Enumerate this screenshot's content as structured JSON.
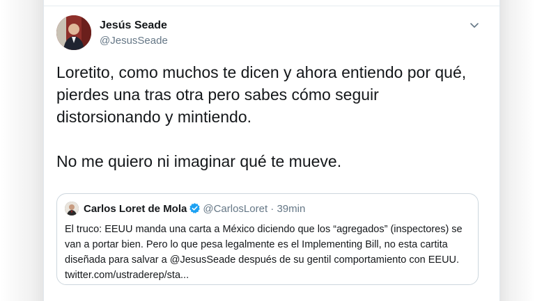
{
  "tweet": {
    "author_name": "Jesús Seade",
    "author_handle": "@JesusSeade",
    "paragraphs": [
      "Loretito, como muchos te dicen y ahora entiendo por qué, pierdes una tras otra pero sabes cómo seguir distorsionando y mintiendo.",
      "No me quiero ni imaginar qué te mueve."
    ],
    "menu_icon": "chevron-down-icon"
  },
  "quoted_tweet": {
    "author_name": "Carlos Loret de Mola",
    "author_handle": "@CarlosLoret",
    "separator": "·",
    "time": "39min",
    "verified_icon": "verified-badge-icon",
    "text": "El truco: EEUU manda una carta a México diciendo que los “agregados” (inspectores) se van a portar bien. Pero lo que pesa legalmente es el Implementing Bill, no esta cartita diseñada para salvar a @JesusSeade después de su gentil comportamiento con EEUU. twitter.com/ustraderep/sta..."
  },
  "colors": {
    "primary_text": "#14171a",
    "secondary_text": "#657786",
    "verified_blue": "#1da1f2",
    "border": "#ccd6dd"
  }
}
